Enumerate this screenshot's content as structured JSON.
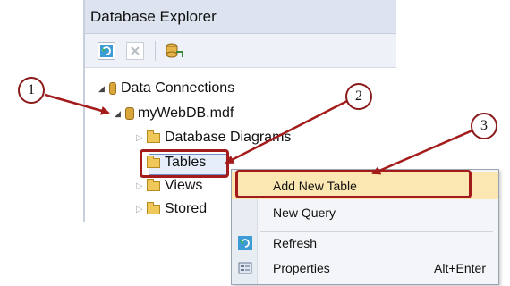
{
  "explorer": {
    "title": "Database Explorer",
    "toolbar": {
      "refresh_icon": "refresh-icon",
      "delete_icon": "delete-icon",
      "connect_icon": "connect-to-database-icon"
    }
  },
  "tree": {
    "root": {
      "label": "Data Connections",
      "icon": "data-connections-icon"
    },
    "db": {
      "label": "myWebDB.mdf",
      "icon": "database-file-icon"
    },
    "children": [
      {
        "label": "Database Diagrams"
      },
      {
        "label": "Tables"
      },
      {
        "label": "Views"
      },
      {
        "label": "Stored"
      }
    ]
  },
  "context_menu": {
    "items": [
      {
        "label": "Add New Table",
        "shortcut": ""
      },
      {
        "label": "New Query",
        "shortcut": ""
      },
      {
        "label": "Refresh",
        "shortcut": ""
      },
      {
        "label": "Properties",
        "shortcut": "Alt+Enter"
      }
    ]
  },
  "callouts": [
    "1",
    "2",
    "3"
  ],
  "colors": {
    "annotation": "#a41b1b",
    "menu_hover": "#fbe7b2",
    "title_bar": "#dde4ef"
  }
}
